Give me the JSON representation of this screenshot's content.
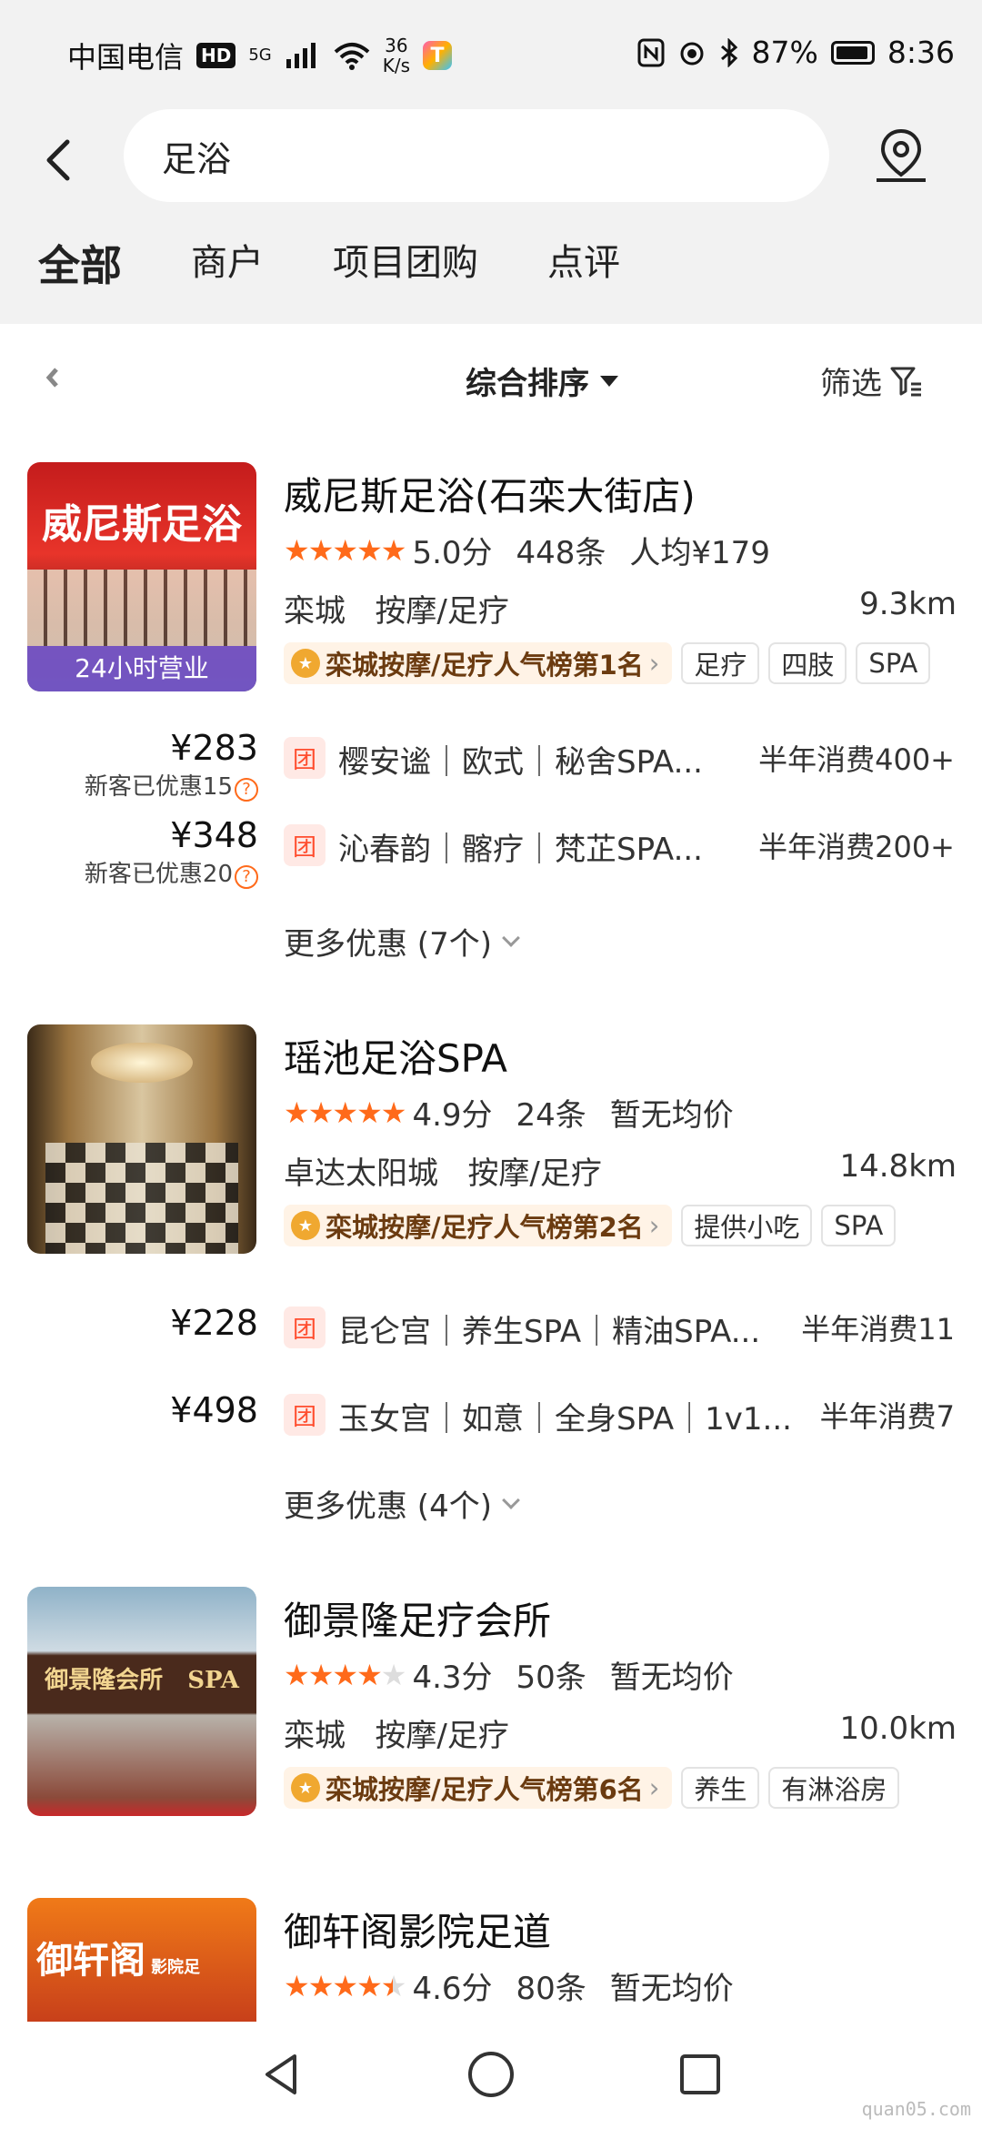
{
  "status_bar": {
    "carrier": "中国电信",
    "hd": "HD",
    "signal_label": "5G",
    "speed_value": "36",
    "speed_unit": "K/s",
    "app_badge": "T",
    "battery": "87%",
    "time": "8:36"
  },
  "search": {
    "query": "足浴"
  },
  "tabs": [
    {
      "label": "全部",
      "active": true
    },
    {
      "label": "商户"
    },
    {
      "label": "项目团购"
    },
    {
      "label": "点评"
    }
  ],
  "sort": {
    "label": "综合排序",
    "filter": "筛选"
  },
  "listings": [
    {
      "name": "威尼斯足浴(石栾大街店)",
      "thumb_sign": "威尼斯足浴",
      "thumb_badge": "24小时营业",
      "score": "5.0分",
      "reviews": "448条",
      "avg": "人均¥179",
      "area": "栾城",
      "category": "按摩/足疗",
      "distance": "9.3km",
      "rank": "栾城按摩/足疗人气榜第1名",
      "tags": [
        "足疗",
        "四肢",
        "SPA"
      ],
      "deals": [
        {
          "price": "¥283",
          "new_customer": "新客已优惠15",
          "tag": "团",
          "name": "樱安谧｜欧式｜秘舍SPA...",
          "sales": "半年消费400+"
        },
        {
          "price": "¥348",
          "new_customer": "新客已优惠20",
          "tag": "团",
          "name": "沁春韵｜髂疗｜梵芷SPA...",
          "sales": "半年消费200+"
        }
      ],
      "more": "更多优惠 (7个)"
    },
    {
      "name": "瑶池足浴SPA",
      "score": "4.9分",
      "reviews": "24条",
      "avg": "暂无均价",
      "area": "卓达太阳城",
      "category": "按摩/足疗",
      "distance": "14.8km",
      "rank": "栾城按摩/足疗人气榜第2名",
      "tags": [
        "提供小吃",
        "SPA"
      ],
      "deals": [
        {
          "price": "¥228",
          "tag": "团",
          "name": "昆仑宫｜养生SPA｜精油SPA...",
          "sales": "半年消费11"
        },
        {
          "price": "¥498",
          "tag": "团",
          "name": "玉女宫｜如意｜全身SPA｜1v1...",
          "sales": "半年消费7"
        }
      ],
      "more": "更多优惠 (4个)"
    },
    {
      "name": "御景隆足疗会所",
      "thumb_sign": "御景隆会所   SPA",
      "score": "4.3分",
      "reviews": "50条",
      "avg": "暂无均价",
      "area": "栾城",
      "category": "按摩/足疗",
      "distance": "10.0km",
      "rank": "栾城按摩/足疗人气榜第6名",
      "tags": [
        "养生",
        "有淋浴房"
      ]
    },
    {
      "name": "御轩阁影院足道",
      "thumb_sign": "御轩阁",
      "thumb_sign_small": "影院足",
      "score": "4.6分",
      "reviews": "80条",
      "avg": "暂无均价"
    }
  ],
  "watermark": "quan05.com",
  "colors": {
    "star": "#ff6a1a",
    "tab_underline": "#ffd100",
    "tuan_tag": "#ff4d2e"
  }
}
